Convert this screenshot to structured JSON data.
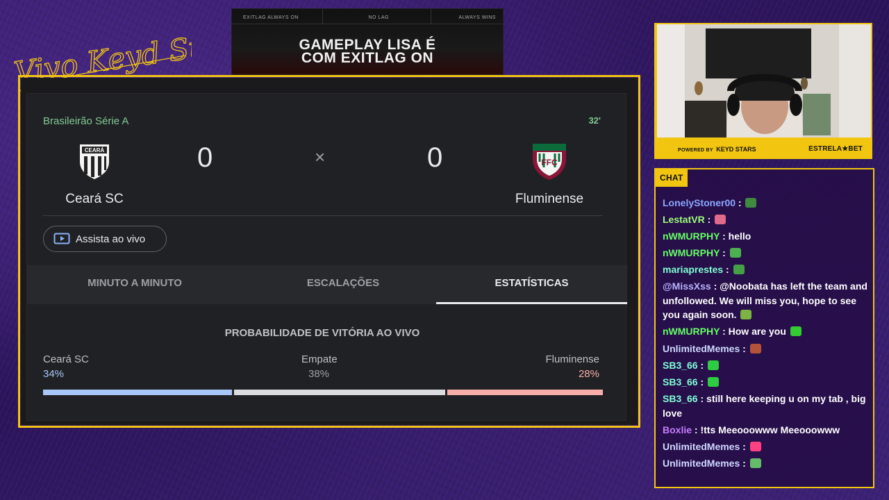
{
  "overlay": {
    "signature_text": "Vivo Keyd Stars"
  },
  "ad_banner": {
    "tag_left": "EXITLAG ALWAYS ON",
    "tag_center": "NO LAG",
    "tag_right": "ALWAYS WINS",
    "headline_line1": "GAMEPLAY LISA É",
    "headline_line2": "COM EXITLAG ON"
  },
  "match": {
    "league": "Brasileirão Série A",
    "minute": "32'",
    "home_team": "Ceará SC",
    "away_team": "Fluminense",
    "home_score": "0",
    "away_score": "0",
    "separator": "×",
    "watch_live_label": "Assista ao vivo",
    "home_crest_text": "CEARÁ",
    "away_crest_text": "FFC"
  },
  "tabs": [
    {
      "label": "MINUTO A MINUTO",
      "active": false
    },
    {
      "label": "ESCALAÇÕES",
      "active": false
    },
    {
      "label": "ESTATÍSTICAS",
      "active": true
    }
  ],
  "win_probability": {
    "title": "PROBABILIDADE DE VITÓRIA AO VIVO",
    "home_label": "Ceará SC",
    "home_value": "34%",
    "home_fraction": 0.34,
    "draw_label": "Empate",
    "draw_value": "38%",
    "draw_fraction": 0.38,
    "away_label": "Fluminense",
    "away_value": "28%",
    "away_fraction": 0.28,
    "colors": {
      "home": "#a8c7fa",
      "draw": "#dadce0",
      "away": "#f6aea9"
    }
  },
  "webcam": {
    "powered_by": "POWERED BY",
    "sponsor_team": "KEYD STARS",
    "sponsor_bet": "ESTRELA★BET"
  },
  "chat": {
    "label": "CHAT",
    "messages": [
      {
        "user": "LonelyStoner00",
        "text": "",
        "emote": "plant-emote",
        "color_class": "u1",
        "partial": true
      },
      {
        "user": "LestatVR",
        "text": "",
        "emote": "flower-emote",
        "color_class": "u2"
      },
      {
        "user": "nWMURPHY",
        "text": "hello",
        "emote": "",
        "color_class": "u5"
      },
      {
        "user": "nWMURPHY",
        "text": "",
        "emote": "frog-emote",
        "color_class": "u5"
      },
      {
        "user": "mariaprestes",
        "text": "",
        "emote": "green-face-emote",
        "color_class": "u3"
      },
      {
        "user": "@MissXss",
        "text": "@Noobata has left the team and unfollowed. We will miss you, hope to see you again soon.",
        "emote": "rocket-emote",
        "color_class": "u4"
      },
      {
        "user": "nWMURPHY",
        "text": "How are you",
        "emote": "heart-emote",
        "color_class": "u5"
      },
      {
        "user": "UnlimitedMemes",
        "text": "",
        "emote": "picture-emote",
        "color_class": "u6"
      },
      {
        "user": "SB3_66",
        "text": "",
        "emote": "chat-emote",
        "color_class": "u3"
      },
      {
        "user": "SB3_66",
        "text": "",
        "emote": "chat-emote",
        "color_class": "u3"
      },
      {
        "user": "SB3_66",
        "text": "still here keeping u on my tab , big love",
        "emote": "",
        "color_class": "u3"
      },
      {
        "user": "Boxlie",
        "text": "!tts Meeooowww Meeooowww",
        "emote": "",
        "color_class": "u7"
      },
      {
        "user": "UnlimitedMemes",
        "text": "",
        "emote": "dance-emote",
        "color_class": "u6"
      },
      {
        "user": "UnlimitedMemes",
        "text": "",
        "emote": "sparkle-emote",
        "color_class": "u6"
      }
    ]
  }
}
